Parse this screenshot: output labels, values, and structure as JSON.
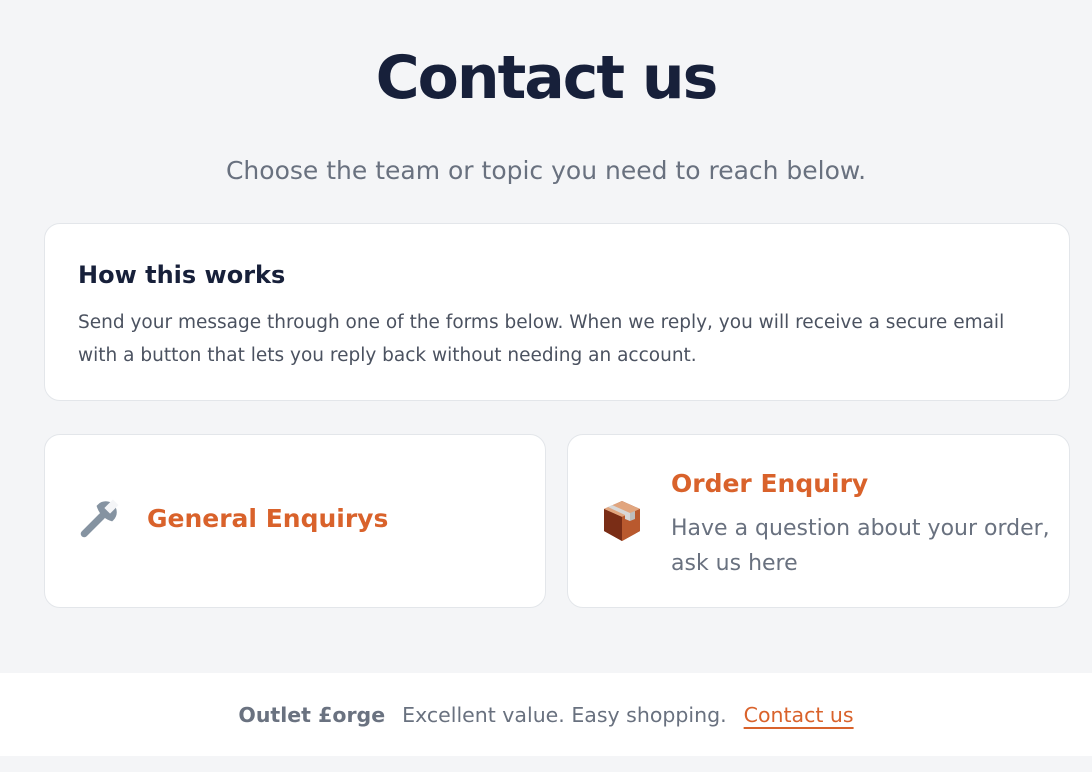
{
  "header": {
    "title": "Contact us",
    "subtitle": "Choose the team or topic you need to reach below."
  },
  "info": {
    "heading": "How this works",
    "text": "Send your message through one of the forms below. When we reply, you will receive a secure email with a button that lets you reply back without needing an account."
  },
  "options": {
    "general": {
      "icon": "wrench-icon",
      "title": "General Enquirys"
    },
    "order": {
      "icon": "package-icon",
      "title": "Order Enquiry",
      "description": "Have a question about your order, ask us here"
    }
  },
  "footer": {
    "brand": "Outlet £orge",
    "tagline": "Excellent value. Easy shopping.",
    "link": "Contact us"
  },
  "colors": {
    "accent": "#d9622b",
    "heading": "#17203a",
    "muted": "#69717f",
    "background": "#f4f5f7"
  }
}
